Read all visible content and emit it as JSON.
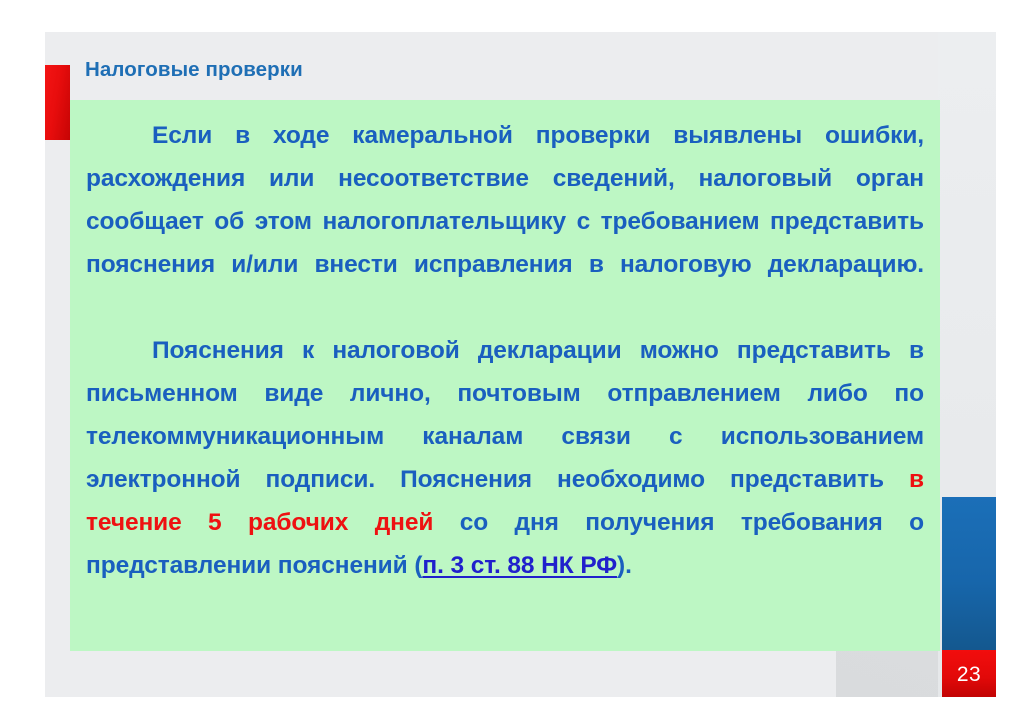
{
  "slide": {
    "title": "Налоговые проверки",
    "page_number": "23",
    "colors": {
      "slide_background": "#ecedef",
      "content_panel": "#bdf7c4",
      "title_blue": "#1f6fb5",
      "body_blue": "#1a5fbf",
      "accent_red": "#e80d0d",
      "emphasis_red": "#ee1111",
      "link_blue": "#2020cc",
      "pager_blue": "#1766ab"
    },
    "paragraphs": {
      "p1": "Если в ходе камеральной проверки выявлены ошибки, расхождения или несоответствие сведений, налоговый орган сообщает об этом налогоплательщику с требованием представить пояснения и/или внести исправления в налоговую декларацию.",
      "p2_part1": "Пояснения к налоговой декларации можно представить в письменном виде лично, почтовым отправлением либо по телекоммуникационным каналам связи с использованием электронной подписи. Пояснения необходимо представить ",
      "p2_red": "в течение 5 рабочих дней",
      "p2_part2": " со дня получения требования о представлении пояснений (",
      "p2_link": "п. 3 ст. 88 НК РФ",
      "p2_part3": ")."
    }
  }
}
